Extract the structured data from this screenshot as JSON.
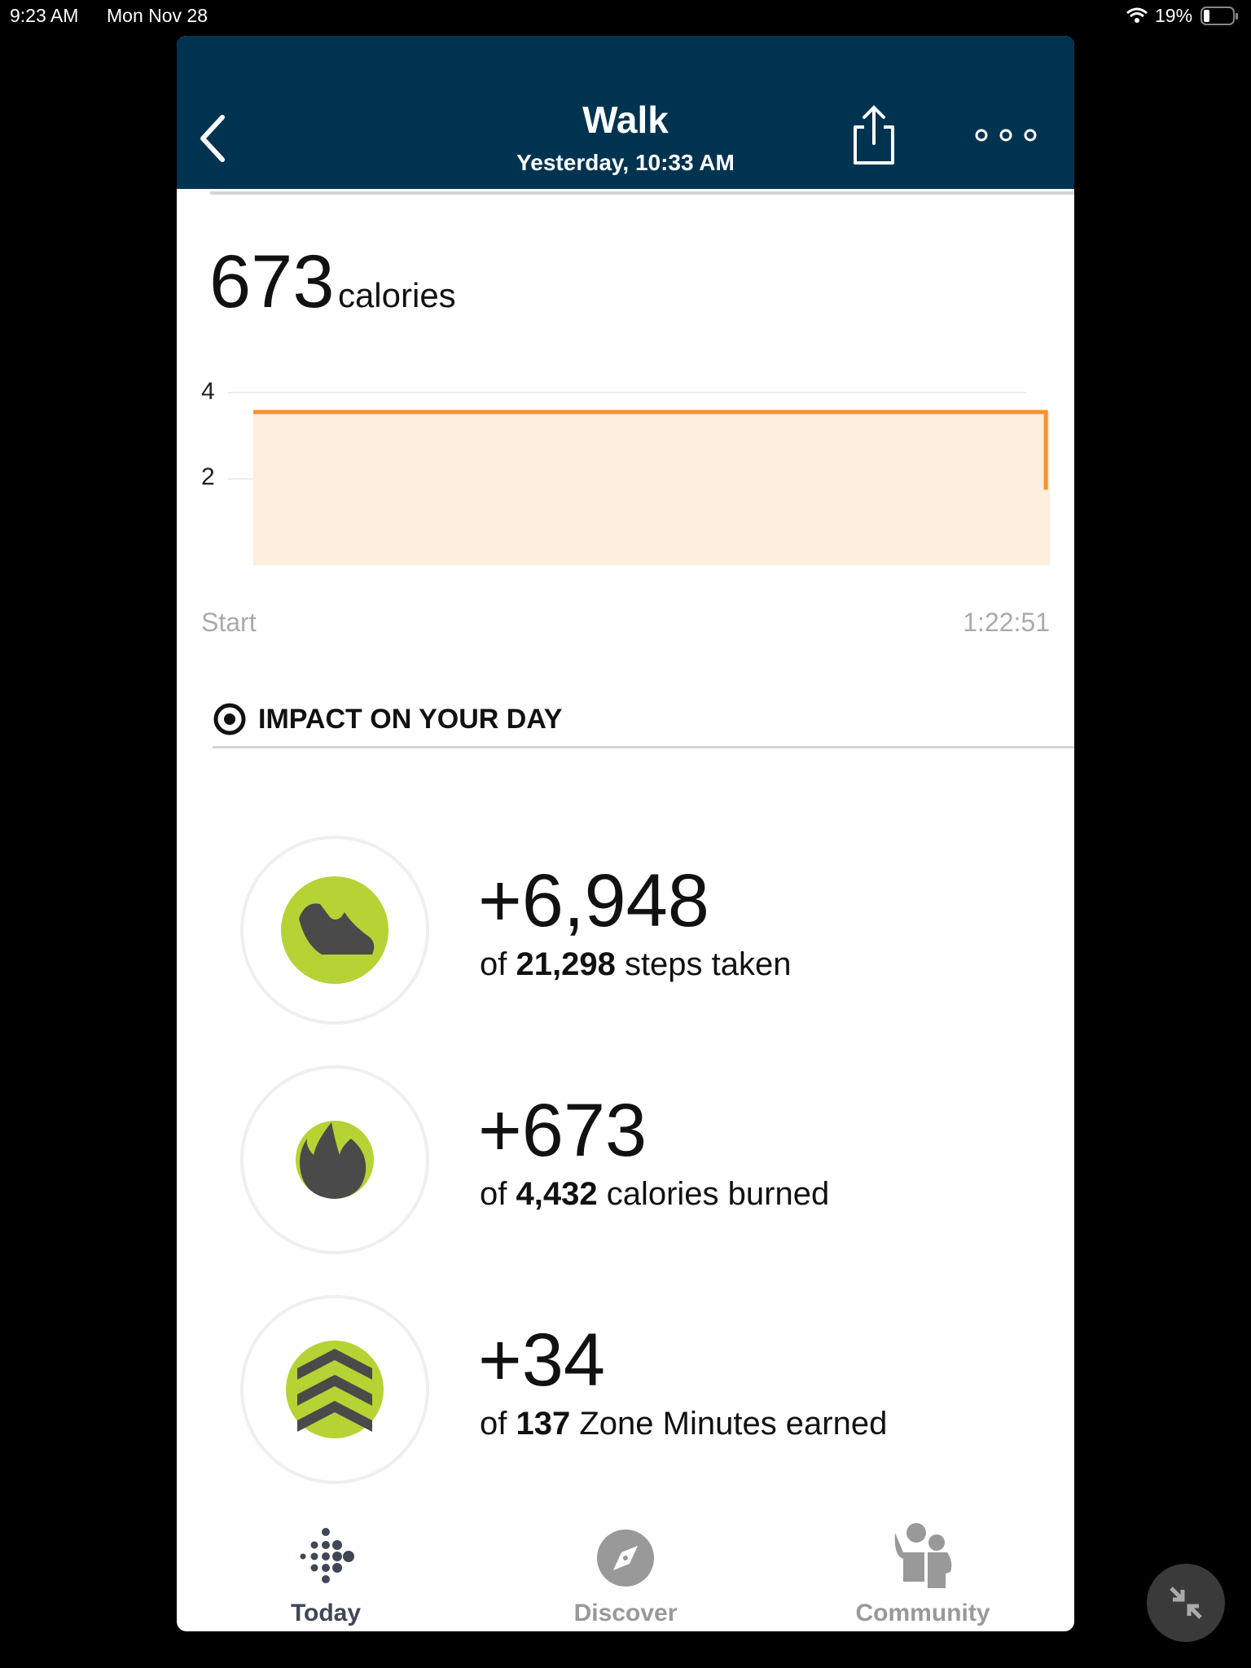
{
  "status_bar": {
    "time": "9:23 AM",
    "date": "Mon Nov 28",
    "battery": "19%"
  },
  "header": {
    "title": "Walk",
    "subtitle": "Yesterday, 10:33 AM"
  },
  "summary": {
    "value": "673",
    "unit": "calories"
  },
  "chart_data": {
    "type": "area",
    "y_ticks": [
      "4",
      "2"
    ],
    "ylim": [
      0,
      4.3
    ],
    "x_labels": {
      "start": "Start",
      "end": "1:22:51"
    },
    "points": [
      {
        "x": 0,
        "y": 3.55
      },
      {
        "x": 0.995,
        "y": 3.55
      },
      {
        "x": 0.995,
        "y": 1.75
      }
    ],
    "line_color": "#f7902d",
    "fill_color": "#fdeedd",
    "grid": true
  },
  "impact": {
    "title": "IMPACT ON YOUR DAY",
    "items": [
      {
        "icon": "shoe-icon",
        "value": "+6,948",
        "prefix": "of ",
        "total": "21,298",
        "suffix": " steps taken"
      },
      {
        "icon": "flame-icon",
        "value": "+673",
        "prefix": "of ",
        "total": "4,432",
        "suffix": " calories burned"
      },
      {
        "icon": "zone-minutes-icon",
        "value": "+34",
        "prefix": "of ",
        "total": "137",
        "suffix": " Zone Minutes earned"
      }
    ],
    "accent": "#b5d334"
  },
  "tabs": [
    {
      "label": "Today",
      "icon": "fitbit-dots-icon",
      "active": true
    },
    {
      "label": "Discover",
      "icon": "compass-icon",
      "active": false
    },
    {
      "label": "Community",
      "icon": "community-icon",
      "active": false
    }
  ],
  "colors": {
    "header_bg": "#003350",
    "active_tab": "#3f4756",
    "inactive_tab": "#999999"
  }
}
